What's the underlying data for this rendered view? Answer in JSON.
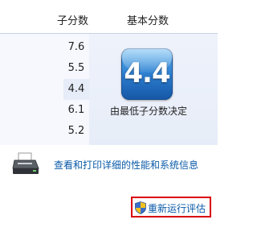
{
  "table": {
    "header_subscore": "子分数",
    "header_base": "基本分数",
    "subscores": [
      "7.6",
      "5.5",
      "4.4",
      "6.1",
      "5.2"
    ],
    "base_score": "4.4",
    "base_description": "由最低子分数决定"
  },
  "links": {
    "view_print": "查看和打印详细的性能和系统信息",
    "rerun": "重新运行评估"
  },
  "icons": {
    "printer": "printer-icon",
    "shield": "uac-shield-icon"
  },
  "colors": {
    "link": "#0a5aa8",
    "highlight_border": "#d9000d",
    "badge": "#2d7ecf"
  }
}
